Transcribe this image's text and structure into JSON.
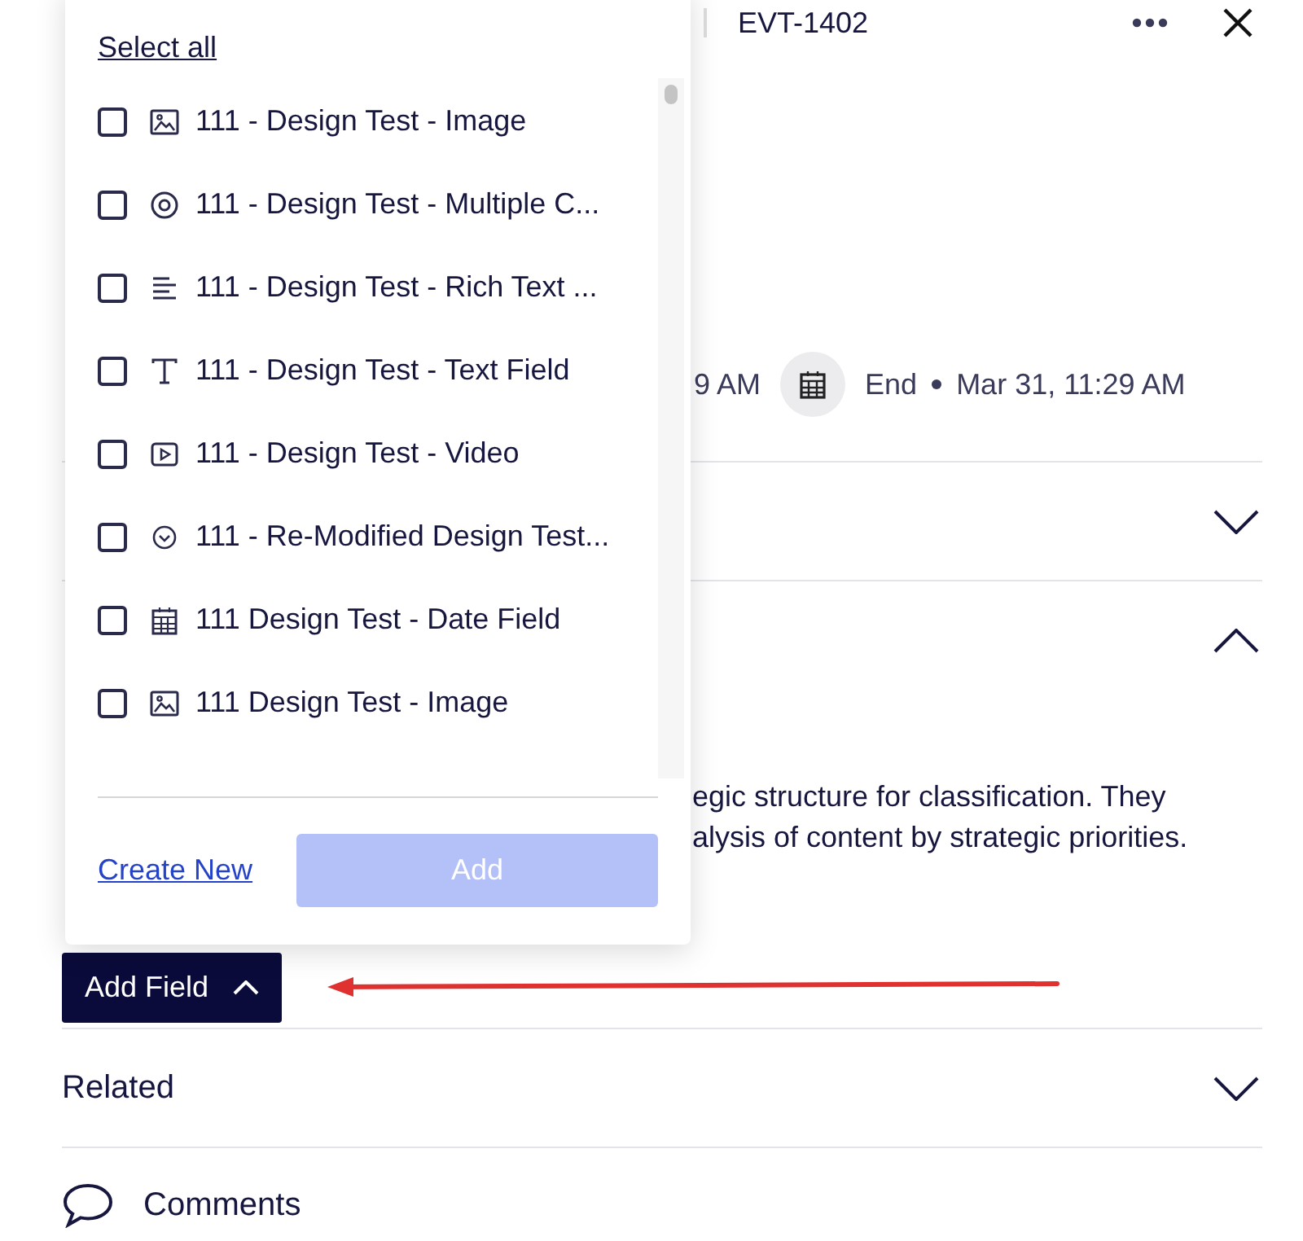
{
  "header": {
    "title": "EVT-1402"
  },
  "date_row": {
    "start_fragment": "9 AM",
    "end_label": "End",
    "end_value": "Mar 31, 11:29 AM"
  },
  "sections": [
    {
      "kind": "plain",
      "expanded": false
    },
    {
      "kind": "description",
      "expanded": true,
      "lines": [
        "egic structure for classification. They",
        "alysis of content by strategic priorities."
      ],
      "add_field": {
        "label": "Add Field",
        "expanded": true
      }
    },
    {
      "kind": "titled",
      "title": "Related",
      "expanded": false
    }
  ],
  "comments": {
    "title": "Comments"
  },
  "popover": {
    "select_all": "Select all",
    "items": [
      {
        "kind": "image",
        "label": "111 - Design Test - Image",
        "checked": false
      },
      {
        "kind": "radio",
        "label": "111 - Design Test - Multiple C...",
        "checked": false
      },
      {
        "kind": "rich_text",
        "label": "111 - Design Test - Rich Text ...",
        "checked": false
      },
      {
        "kind": "text",
        "label": "111 - Design Test - Text Field",
        "checked": false
      },
      {
        "kind": "video",
        "label": "111 - Design Test - Video",
        "checked": false
      },
      {
        "kind": "dropdown",
        "label": "111 - Re-Modified Design Test...",
        "checked": false
      },
      {
        "kind": "date",
        "label": "111 Design Test - Date Field",
        "checked": false
      },
      {
        "kind": "image",
        "label": "111 Design Test - Image",
        "checked": false
      }
    ],
    "create_new": "Create New",
    "add_button": {
      "label": "Add",
      "disabled": true
    }
  }
}
